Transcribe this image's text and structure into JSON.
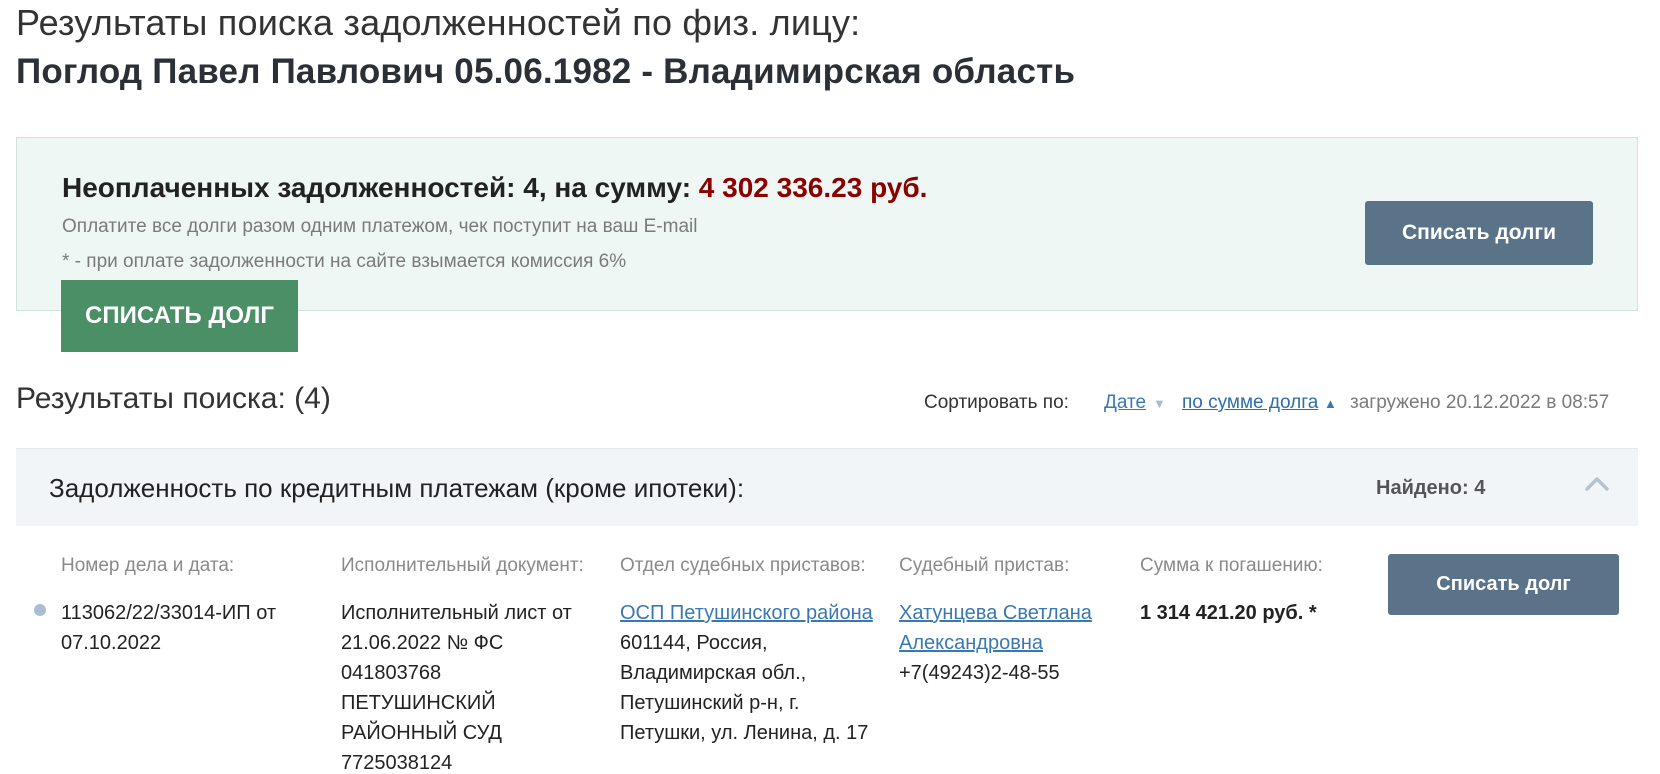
{
  "header": {
    "title": "Результаты поиска задолженностей по физ. лицу:",
    "subject": "Поглод Павел Павлович 05.06.1982 - Владимирская область"
  },
  "summary": {
    "label": "Неоплаченных задолженностей: 4, на сумму:",
    "amount": "4 302 336.23 руб.",
    "note": "Оплатите все долги разом одним платежом, чек поступит на ваш E-mail",
    "commission": "* - при оплате задолженности на сайте взымается комиссия 6%",
    "pay_all_button": "Списать долги",
    "pay_button": "СПИСАТЬ ДОЛГ"
  },
  "results": {
    "title": "Результаты поиска: (4)",
    "sort_label": "Сортировать по:",
    "sort_date": "Дате",
    "sort_sum": "по сумме долга",
    "loaded": "загружено 20.12.2022 в 08:57"
  },
  "category": {
    "title": "Задолженность по кредитным платежам (кроме ипотеки):",
    "found_label": "Найдено:",
    "found_count": "4"
  },
  "table": {
    "columns": [
      "Номер дела и дата:",
      "Исполнительный документ:",
      "Отдел судебных приставов:",
      "Судебный пристав:",
      "Сумма к погашению:"
    ],
    "rows": [
      {
        "case": "113062/22/33014-ИП от 07.10.2022",
        "document": "Исполнительный лист от 21.06.2022 № ФС 041803768 ПЕТУШИНСКИЙ РАЙОННЫЙ СУД 7725038124",
        "department_link": "ОСП Петушинского района",
        "department_address": "601144, Россия, Владимирская обл., Петушинский р-н, г. Петушки, ул. Ленина, д. 17",
        "bailiff_link": "Хатунцева Светлана Александровна",
        "bailiff_phone": "+7(49243)2-48-55",
        "amount": "1 314 421.20 руб.",
        "amount_suffix": " *",
        "pay_button": "Списать долг"
      }
    ]
  },
  "colors": {
    "accent_slate": "#5a7388",
    "accent_green": "#4a8f65",
    "amount_red": "#8b0000",
    "link_blue": "#3a78b0"
  },
  "icons": {
    "sort_desc": "triangle-down-icon",
    "sort_asc": "triangle-up-icon",
    "collapse": "chevron-up-icon",
    "bullet": "dot-icon"
  }
}
